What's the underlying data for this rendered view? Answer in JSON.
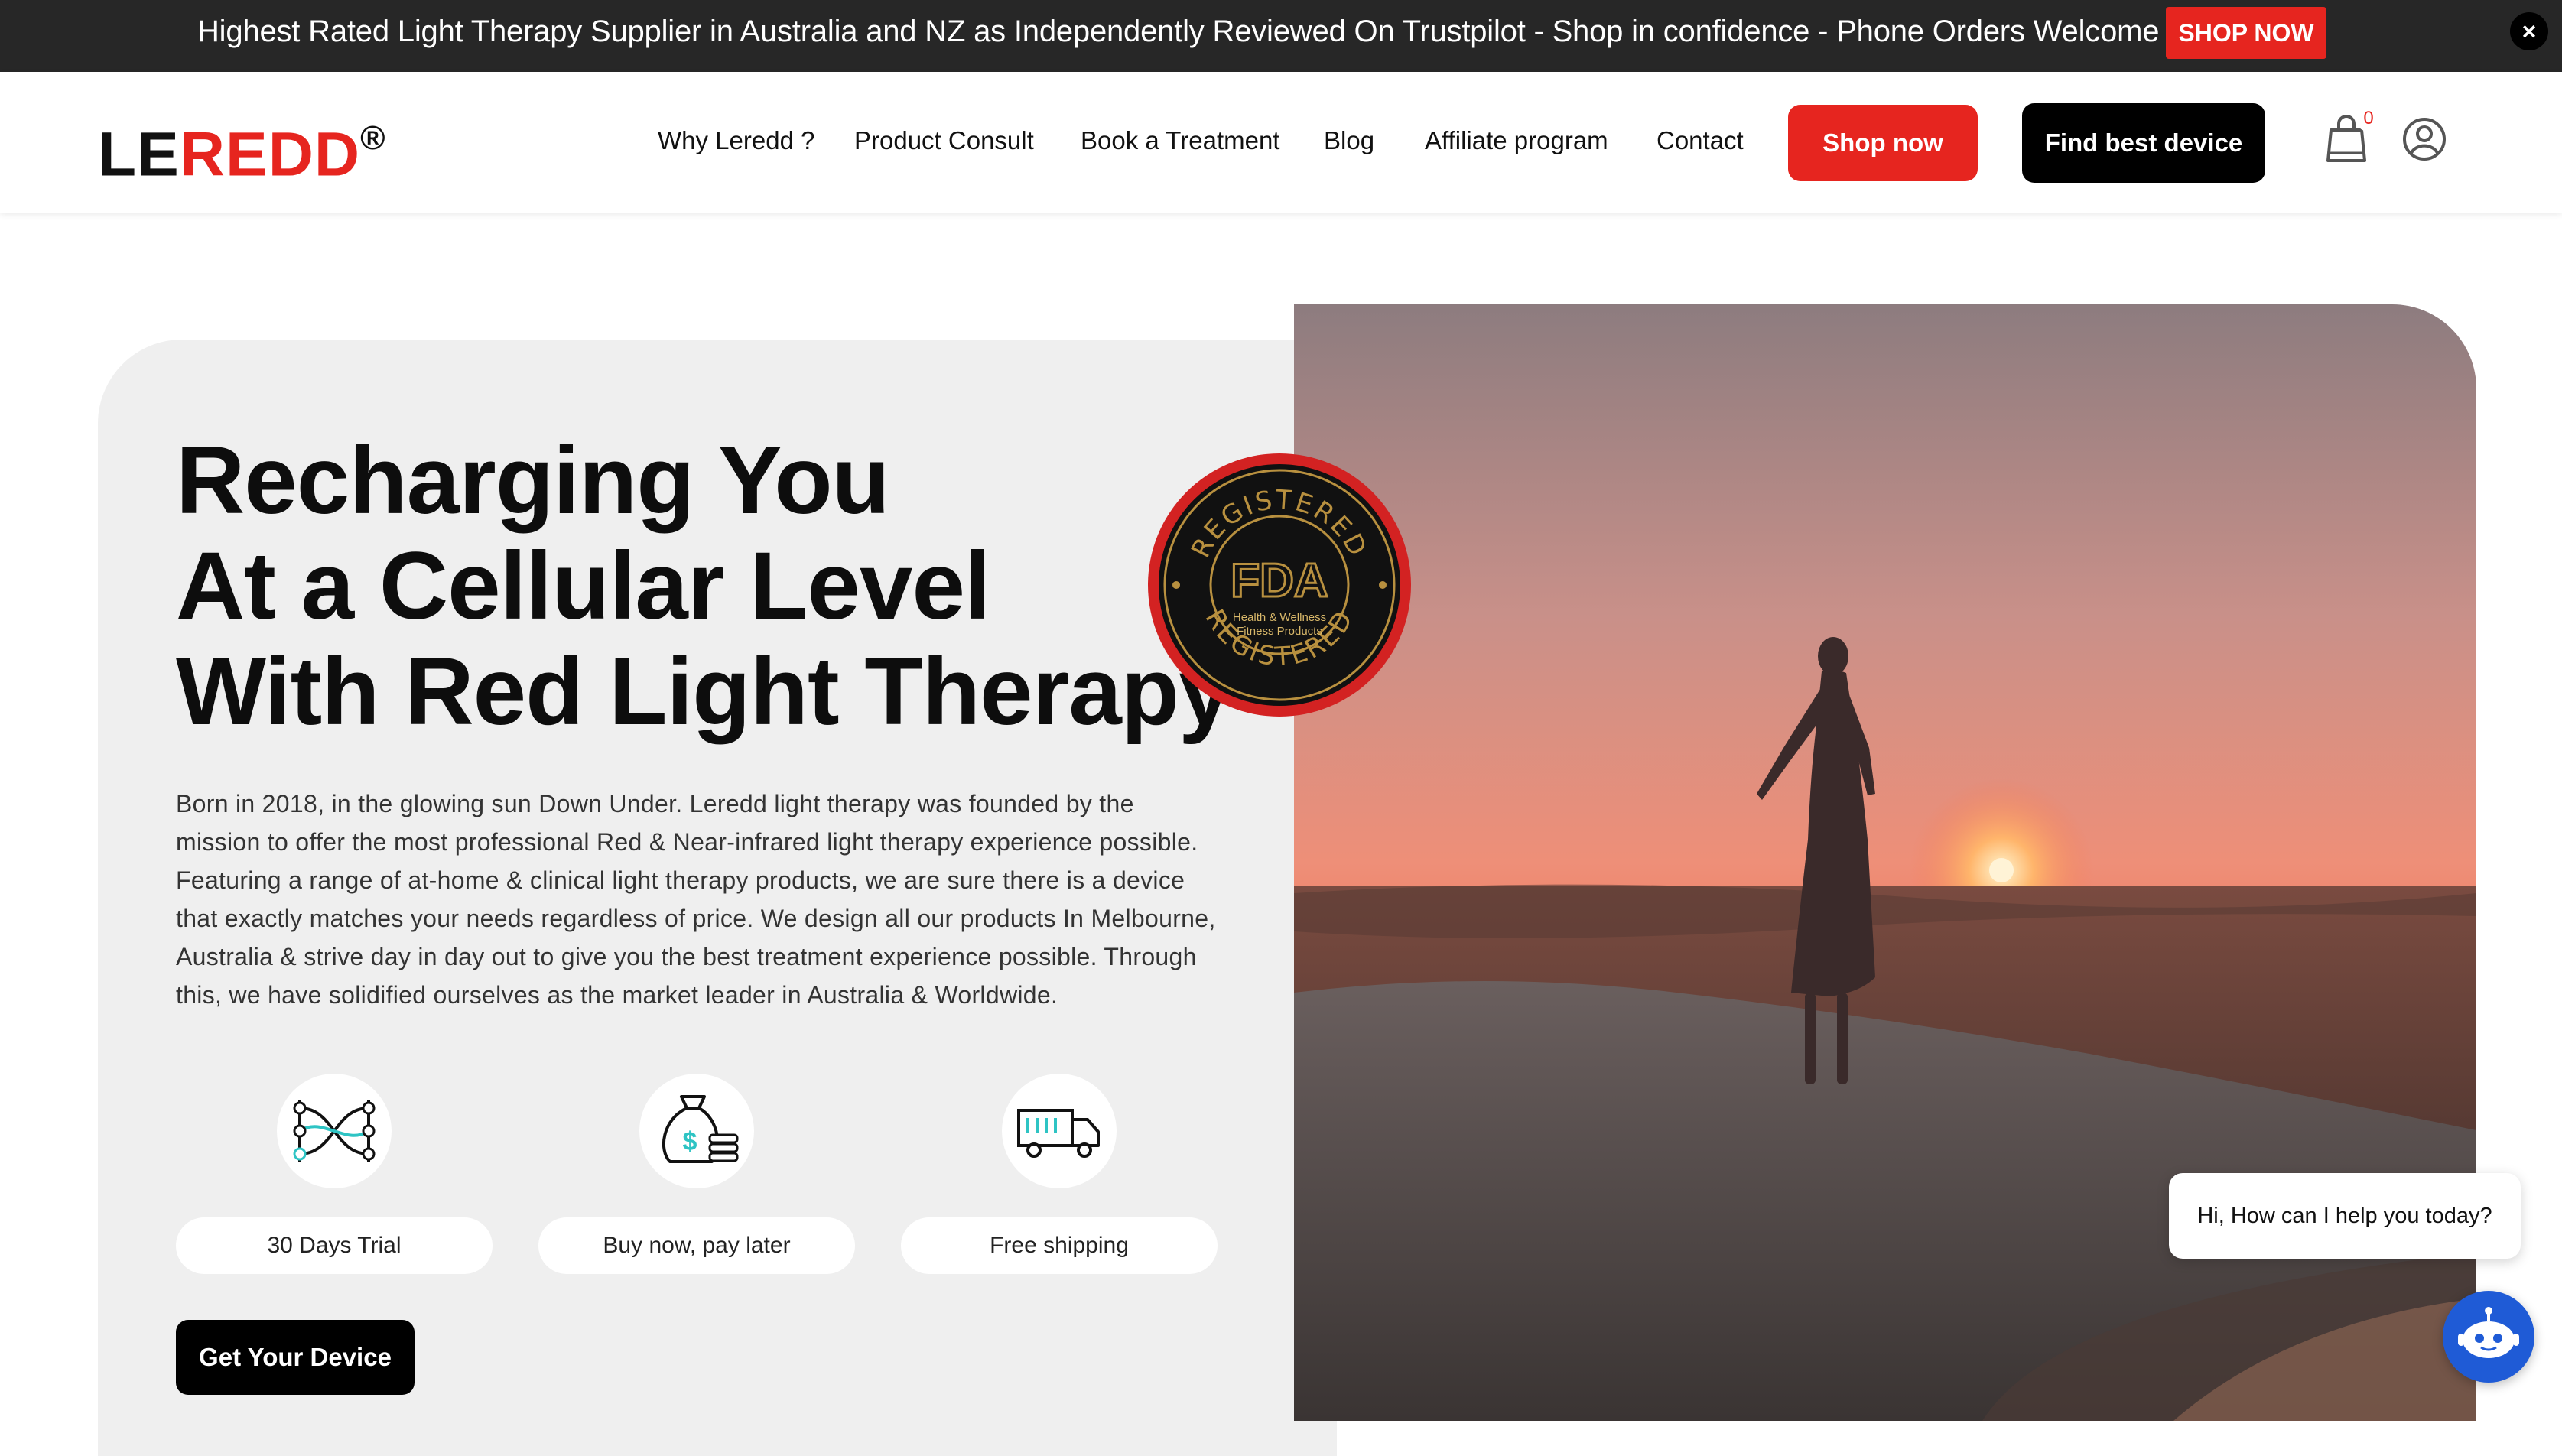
{
  "announcement": {
    "text": "Highest Rated Light Therapy Supplier in Australia and NZ as Independently Reviewed On Trustpilot - Shop in confidence - Phone Orders Welcome",
    "cta": "SHOP NOW",
    "close": "×"
  },
  "header": {
    "logo": {
      "part1": "LE",
      "part2": "REDD",
      "reg": "®"
    },
    "nav": [
      {
        "label": "Why Leredd ?"
      },
      {
        "label": "Product Consult"
      },
      {
        "label": "Book a Treatment"
      },
      {
        "label": "Blog"
      },
      {
        "label": "Affiliate program"
      },
      {
        "label": "Contact"
      }
    ],
    "shop_button": "Shop now",
    "find_button": "Find best device",
    "cart_count": "0"
  },
  "hero": {
    "headline": [
      "Recharging You",
      "At a Cellular Level",
      "With Red Light Therapy"
    ],
    "intro": "Born in 2018, in the glowing sun Down Under. Leredd light therapy was founded by the mission to offer the most professional Red & Near-infrared light therapy experience possible. Featuring a range of at-home & clinical light therapy products, we are sure there is a device that exactly matches your needs regardless of price. We design all our products In Melbourne, Australia & strive day in day out to give you the best treatment experience possible. Through this, we have solidified ourselves as the market leader in Australia & Worldwide.",
    "badge": {
      "top": "REGISTERED",
      "bottom": "REGISTERED",
      "mark": "FDA",
      "line1": "Health & Wellness",
      "line2": "Fitness Products"
    },
    "features": [
      {
        "label": "30 Days Trial",
        "icon": "dna-icon"
      },
      {
        "label": "Buy now, pay later",
        "icon": "money-bag-icon"
      },
      {
        "label": "Free shipping",
        "icon": "truck-icon"
      }
    ],
    "cta": "Get Your Device"
  },
  "chat": {
    "greeting": "Hi, How can I help you today?"
  },
  "colors": {
    "accent_red": "#e6251f",
    "dark_bar": "#272727",
    "hero_panel": "#efefef",
    "chat_blue": "#1f5bd6",
    "icon_teal": "#2ec4c4"
  }
}
